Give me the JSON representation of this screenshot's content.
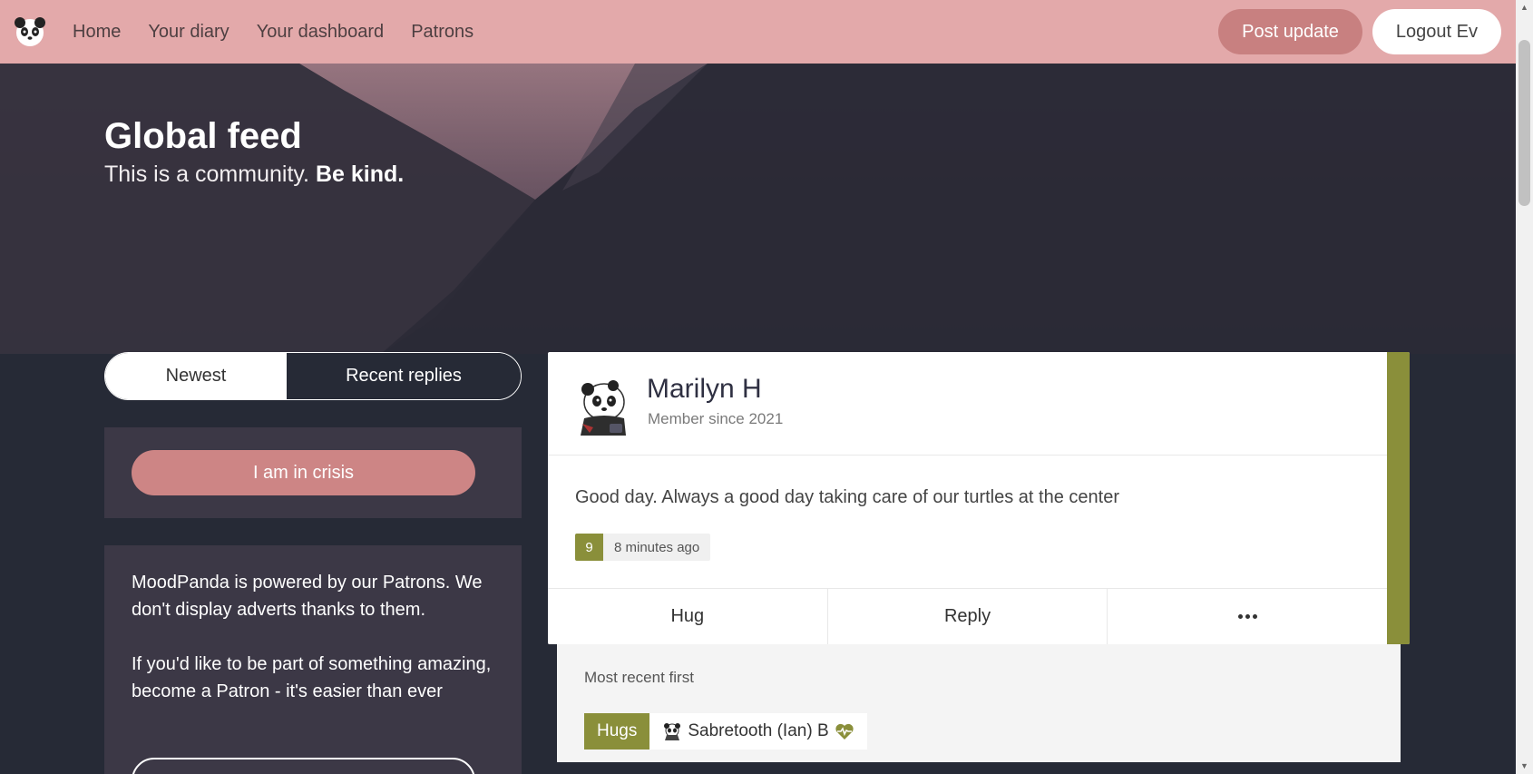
{
  "nav": {
    "links": [
      "Home",
      "Your diary",
      "Your dashboard",
      "Patrons"
    ],
    "post_update": "Post update",
    "logout": "Logout Ev"
  },
  "hero": {
    "title": "Global feed",
    "subtitle_plain": "This is a community. ",
    "subtitle_bold": "Be kind."
  },
  "tabs": {
    "newest": "Newest",
    "recent_replies": "Recent replies"
  },
  "crisis": {
    "button": "I am in crisis"
  },
  "patron": {
    "line1": "MoodPanda is powered by our Patrons. We don't display adverts thanks to them.",
    "line2": "If you'd like to be part of something amazing, become a Patron - it's easier than ever"
  },
  "post": {
    "user_name": "Marilyn H",
    "member_since": "Member since 2021",
    "body": "Good day. Always a good day taking care of our turtles at the center",
    "mood": "9",
    "time": "8 minutes ago",
    "actions": {
      "hug": "Hug",
      "reply": "Reply"
    },
    "accent_color": "#8a8f3a"
  },
  "replies": {
    "sort_label": "Most recent first",
    "hugs_label": "Hugs",
    "huggers": [
      "Sabretooth (Ian) B"
    ]
  },
  "colors": {
    "nav_bg": "#e3a9aa",
    "crisis": "#cd8585",
    "page_bg": "#262a36"
  },
  "icons": [
    "panda-logo-icon",
    "panda-avatar-icon",
    "more-dots-icon",
    "heart-pulse-icon"
  ]
}
